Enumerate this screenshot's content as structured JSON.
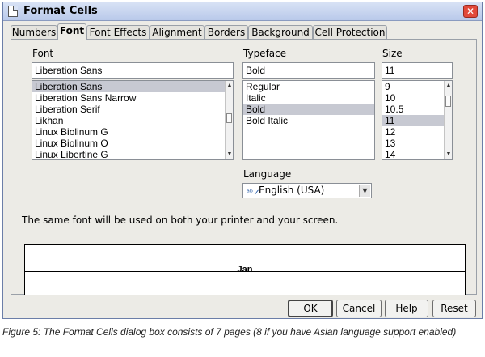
{
  "window": {
    "title": "Format Cells",
    "close_glyph": "✕",
    "icon": "document-icon"
  },
  "tabs": [
    {
      "label": "Numbers",
      "active": false
    },
    {
      "label": "Font",
      "active": true
    },
    {
      "label": "Font Effects",
      "active": false
    },
    {
      "label": "Alignment",
      "active": false
    },
    {
      "label": "Borders",
      "active": false
    },
    {
      "label": "Background",
      "active": false
    },
    {
      "label": "Cell Protection",
      "active": false
    }
  ],
  "font": {
    "label": "Font",
    "value": "Liberation Sans",
    "items": [
      "Liberation Sans",
      "Liberation Sans Narrow",
      "Liberation Serif",
      "Likhan",
      "Linux Biolinum G",
      "Linux Biolinum O",
      "Linux Libertine G"
    ],
    "selected": "Liberation Sans"
  },
  "typeface": {
    "label": "Typeface",
    "value": "Bold",
    "items": [
      "Regular",
      "Italic",
      "Bold",
      "Bold Italic"
    ],
    "selected": "Bold"
  },
  "size": {
    "label": "Size",
    "value": "11",
    "items": [
      "9",
      "10",
      "10.5",
      "11",
      "12",
      "13",
      "14"
    ],
    "selected": "11"
  },
  "language": {
    "label": "Language",
    "value": "English (USA)",
    "icon": "spellcheck-icon"
  },
  "info_text": "The same font will be used on both your printer and your screen.",
  "preview_text": "Jan",
  "buttons": {
    "ok": "OK",
    "cancel": "Cancel",
    "help": "Help",
    "reset": "Reset"
  },
  "caption": "Figure 5: The Format Cells dialog box consists of 7 pages (8 if you have Asian language support enabled)"
}
